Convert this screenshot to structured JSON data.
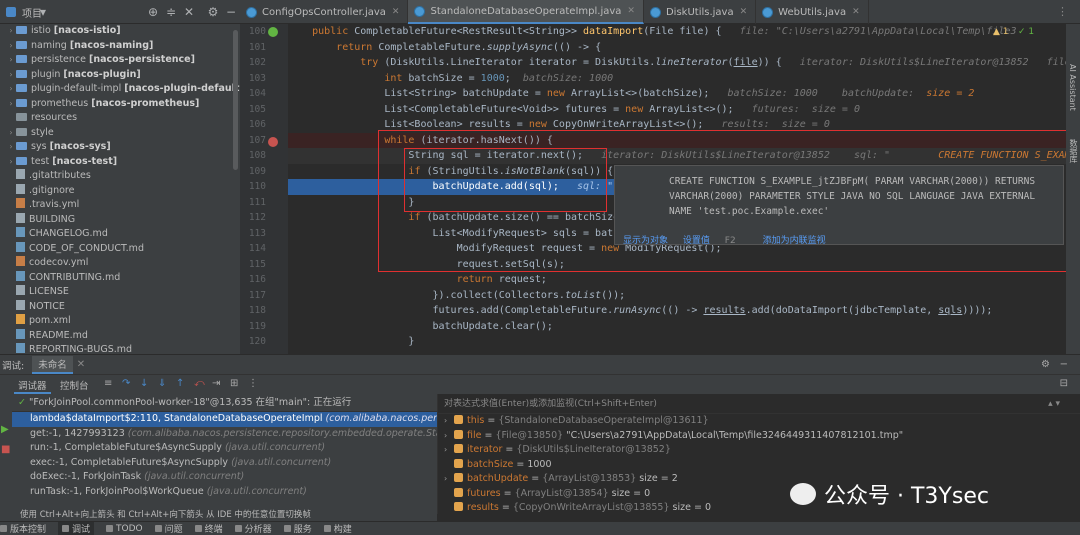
{
  "project_panel": {
    "title": "项目"
  },
  "tabs": [
    {
      "label": "ConfigOpsController.java",
      "active": false
    },
    {
      "label": "StandaloneDatabaseOperateImpl.java",
      "active": true
    },
    {
      "label": "DiskUtils.java",
      "active": false
    },
    {
      "label": "WebUtils.java",
      "active": false
    }
  ],
  "tree": [
    {
      "arrow": "›",
      "icon": "folder",
      "name": "istio",
      "module": "[nacos-istio]"
    },
    {
      "arrow": "›",
      "icon": "folder",
      "name": "naming",
      "module": "[nacos-naming]"
    },
    {
      "arrow": "›",
      "icon": "folder",
      "name": "persistence",
      "module": "[nacos-persistence]"
    },
    {
      "arrow": "›",
      "icon": "folder",
      "name": "plugin",
      "module": "[nacos-plugin]"
    },
    {
      "arrow": "›",
      "icon": "folder",
      "name": "plugin-default-impl",
      "module": "[nacos-plugin-default-impl]"
    },
    {
      "arrow": "›",
      "icon": "folder",
      "name": "prometheus",
      "module": "[nacos-prometheus]"
    },
    {
      "arrow": "",
      "icon": "folder-plain",
      "name": "resources",
      "module": ""
    },
    {
      "arrow": "›",
      "icon": "folder-plain",
      "name": "style",
      "module": ""
    },
    {
      "arrow": "›",
      "icon": "folder",
      "name": "sys",
      "module": "[nacos-sys]"
    },
    {
      "arrow": "›",
      "icon": "folder",
      "name": "test",
      "module": "[nacos-test]"
    },
    {
      "arrow": "",
      "icon": "file",
      "name": ".gitattributes",
      "module": ""
    },
    {
      "arrow": "",
      "icon": "file",
      "name": ".gitignore",
      "module": ""
    },
    {
      "arrow": "",
      "icon": "yml",
      "name": ".travis.yml",
      "module": ""
    },
    {
      "arrow": "",
      "icon": "file",
      "name": "BUILDING",
      "module": ""
    },
    {
      "arrow": "",
      "icon": "md",
      "name": "CHANGELOG.md",
      "module": ""
    },
    {
      "arrow": "",
      "icon": "md",
      "name": "CODE_OF_CONDUCT.md",
      "module": ""
    },
    {
      "arrow": "",
      "icon": "yml",
      "name": "codecov.yml",
      "module": ""
    },
    {
      "arrow": "",
      "icon": "md",
      "name": "CONTRIBUTING.md",
      "module": ""
    },
    {
      "arrow": "",
      "icon": "file",
      "name": "LICENSE",
      "module": ""
    },
    {
      "arrow": "",
      "icon": "file",
      "name": "NOTICE",
      "module": ""
    },
    {
      "arrow": "",
      "icon": "xml",
      "name": "pom.xml",
      "module": ""
    },
    {
      "arrow": "",
      "icon": "md",
      "name": "README.md",
      "module": ""
    },
    {
      "arrow": "",
      "icon": "md",
      "name": "REPORTING-BUGS.md",
      "module": ""
    }
  ],
  "line_numbers": [
    "100",
    "101",
    "102",
    "103",
    "104",
    "105",
    "106",
    "107",
    "108",
    "109",
    "110",
    "111",
    "112",
    "113",
    "114",
    "115",
    "116",
    "117",
    "118",
    "119",
    "120"
  ],
  "code_hints": {
    "file_hint": "file: \"C:\\Users\\a2791\\AppData\\Local\\Temp\\file3",
    "iterator_hint": "iterator: DiskUtils$LineIterator@13852",
    "file_hint2": "file: \"C",
    "batchsize_hint": "batchSize: 1000",
    "batchupdate_hint": "batchSize: 1000",
    "batchupdate_hint2": "batchUpdate:",
    "batchupdate_hint3": "size = 2",
    "futures_hint": "futures:  size = 0",
    "results_hint": "results:  size = 0",
    "iter_hint108": "iterator: DiskUtils$LineIterator@13852",
    "sql_hint108": "sql: \"",
    "sql_val108": "CREATE FUNCTION S_EXAMPLE_j",
    "sql_hint110": "sql: \""
  },
  "warnings": {
    "warn": "▲ 1",
    "ok": "✓ 1"
  },
  "tooltip": {
    "line1": "CREATE FUNCTION S_EXAMPLE_jtZJBFpM( PARAM VARCHAR(2000)) RETURNS",
    "line2": "VARCHAR(2000) PARAMETER STYLE JAVA NO SQL LANGUAGE JAVA EXTERNAL",
    "line3": "NAME 'test.poc.Example.exec'",
    "link_view": "显示为对象",
    "link_set": "设置值",
    "link_set_key": "F2",
    "link_watch": "添加为内联监视"
  },
  "right_bar": {
    "ai": "AI Assistant",
    "db": "数据库"
  },
  "debug": {
    "label": "调试:",
    "session": "未命名",
    "tab_debugger": "调试器",
    "tab_console": "控制台",
    "thread": "\"ForkJoinPool.commonPool-worker-18\"@13,635 在组\"main\": 正在运行",
    "eval_placeholder": "对表达式求值(Enter)或添加监视(Ctrl+Shift+Enter)",
    "frames": [
      {
        "method": "lambda$dataImport$2:110, StandaloneDatabaseOperateImpl",
        "pkg": "(com.alibaba.nacos.persistence.rep",
        "selected": true
      },
      {
        "method": "get:-1, 1427993123",
        "pkg": "(com.alibaba.nacos.persistence.repository.embedded.operate.StandaloneDa",
        "selected": false
      },
      {
        "method": "run:-1, CompletableFuture$AsyncSupply",
        "pkg": "(java.util.concurrent)",
        "selected": false
      },
      {
        "method": "exec:-1, CompletableFuture$AsyncSupply",
        "pkg": "(java.util.concurrent)",
        "selected": false
      },
      {
        "method": "doExec:-1, ForkJoinTask",
        "pkg": "(java.util.concurrent)",
        "selected": false
      },
      {
        "method": "runTask:-1, ForkJoinPool$WorkQueue",
        "pkg": "(java.util.concurrent)",
        "selected": false
      }
    ],
    "hint": "使用 Ctrl+Alt+向上箭头 和 Ctrl+Alt+向下箭头 从 IDE 中的任意位置切换帧",
    "vars": [
      {
        "arrow": "›",
        "name": "this",
        "eq": " = ",
        "type": "{StandaloneDatabaseOperateImpl@13611}",
        "val": ""
      },
      {
        "arrow": "›",
        "name": "file",
        "eq": " = ",
        "type": "{File@13850}",
        "val": " \"C:\\Users\\a2791\\AppData\\Local\\Temp\\file3246449311407812101.tmp\""
      },
      {
        "arrow": "›",
        "name": "iterator",
        "eq": " = ",
        "type": "{DiskUtils$LineIterator@13852}",
        "val": ""
      },
      {
        "arrow": "",
        "name": "batchSize",
        "eq": " = ",
        "type": "",
        "val": "1000"
      },
      {
        "arrow": "›",
        "name": "batchUpdate",
        "eq": " = ",
        "type": "{ArrayList@13853}",
        "val": "  size = 2"
      },
      {
        "arrow": "",
        "name": "futures",
        "eq": " = ",
        "type": "{ArrayList@13854}",
        "val": "  size = 0"
      },
      {
        "arrow": "",
        "name": "results",
        "eq": " = ",
        "type": "{CopyOnWriteArrayList@13855}",
        "val": "  size = 0"
      }
    ]
  },
  "bottom_bar": [
    {
      "label": "版本控制",
      "active": false
    },
    {
      "label": "调试",
      "active": true
    },
    {
      "label": "TODO",
      "active": false
    },
    {
      "label": "问题",
      "active": false
    },
    {
      "label": "终端",
      "active": false
    },
    {
      "label": "分析器",
      "active": false
    },
    {
      "label": "服务",
      "active": false
    },
    {
      "label": "构建",
      "active": false
    }
  ],
  "watermark": "公众号 · T3Ysec"
}
